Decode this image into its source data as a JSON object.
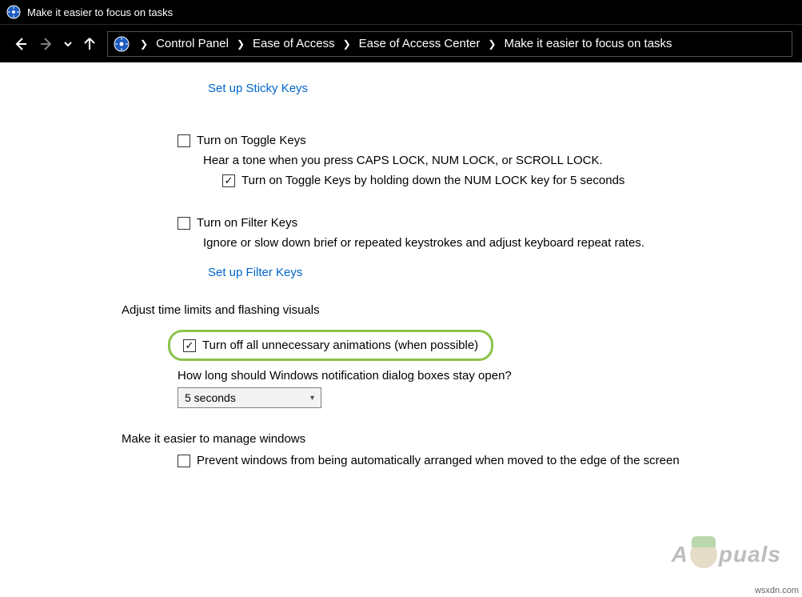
{
  "window": {
    "title": "Make it easier to focus on tasks"
  },
  "breadcrumb": {
    "items": [
      "Control Panel",
      "Ease of Access",
      "Ease of Access Center",
      "Make it easier to focus on tasks"
    ]
  },
  "links": {
    "sticky_keys": "Set up Sticky Keys",
    "filter_keys": "Set up Filter Keys"
  },
  "sections": {
    "toggle_keys": {
      "checkbox_label": "Turn on Toggle Keys",
      "description": "Hear a tone when you press CAPS LOCK, NUM LOCK, or SCROLL LOCK.",
      "sub_checkbox_label": "Turn on Toggle Keys by holding down the NUM LOCK key for 5 seconds"
    },
    "filter_keys": {
      "checkbox_label": "Turn on Filter Keys",
      "description": "Ignore or slow down brief or repeated keystrokes and adjust keyboard repeat rates."
    },
    "time_limits": {
      "heading": "Adjust time limits and flashing visuals",
      "checkbox_label": "Turn off all unnecessary animations (when possible)",
      "notification_label": "How long should Windows notification dialog boxes stay open?",
      "dropdown_value": "5 seconds"
    },
    "manage_windows": {
      "heading": "Make it easier to manage windows",
      "checkbox_label": "Prevent windows from being automatically arranged when moved to the edge of the screen"
    }
  },
  "watermark": {
    "text_left": "A",
    "text_right": "puals"
  },
  "source": "wsxdn.com"
}
